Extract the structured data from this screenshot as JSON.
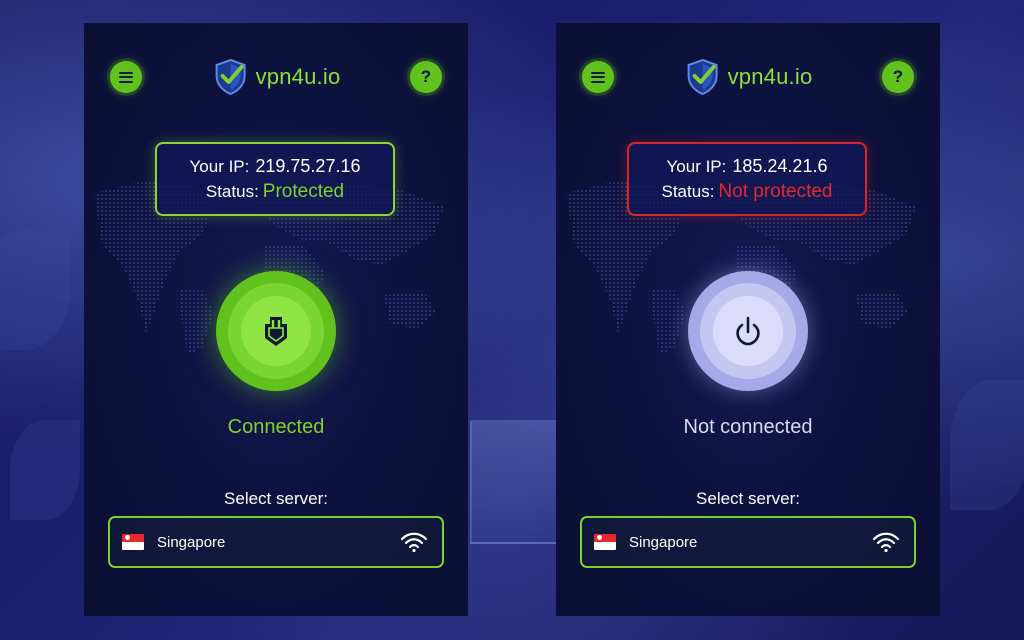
{
  "brand": {
    "name": "vpn4u.io",
    "green": "#62c21d",
    "red": "#e8262c"
  },
  "screens": [
    {
      "ip_label": "Your IP:",
      "ip": "219.75.27.16",
      "status_label": "Status:",
      "status": "Protected",
      "connection": "Connected",
      "select_label": "Select server:",
      "server": "Singapore"
    },
    {
      "ip_label": "Your IP:",
      "ip": "185.24.21.6",
      "status_label": "Status:",
      "status": "Not protected",
      "connection": "Not connected",
      "select_label": "Select server:",
      "server": "Singapore"
    }
  ],
  "icons": {
    "menu": "hamburger-menu-icon",
    "help": "?",
    "logo": "shield-check-icon",
    "power_on": "shield-plug-icon",
    "power_off": "power-icon",
    "signal": "wifi-icon",
    "flag": "singapore-flag-icon"
  }
}
